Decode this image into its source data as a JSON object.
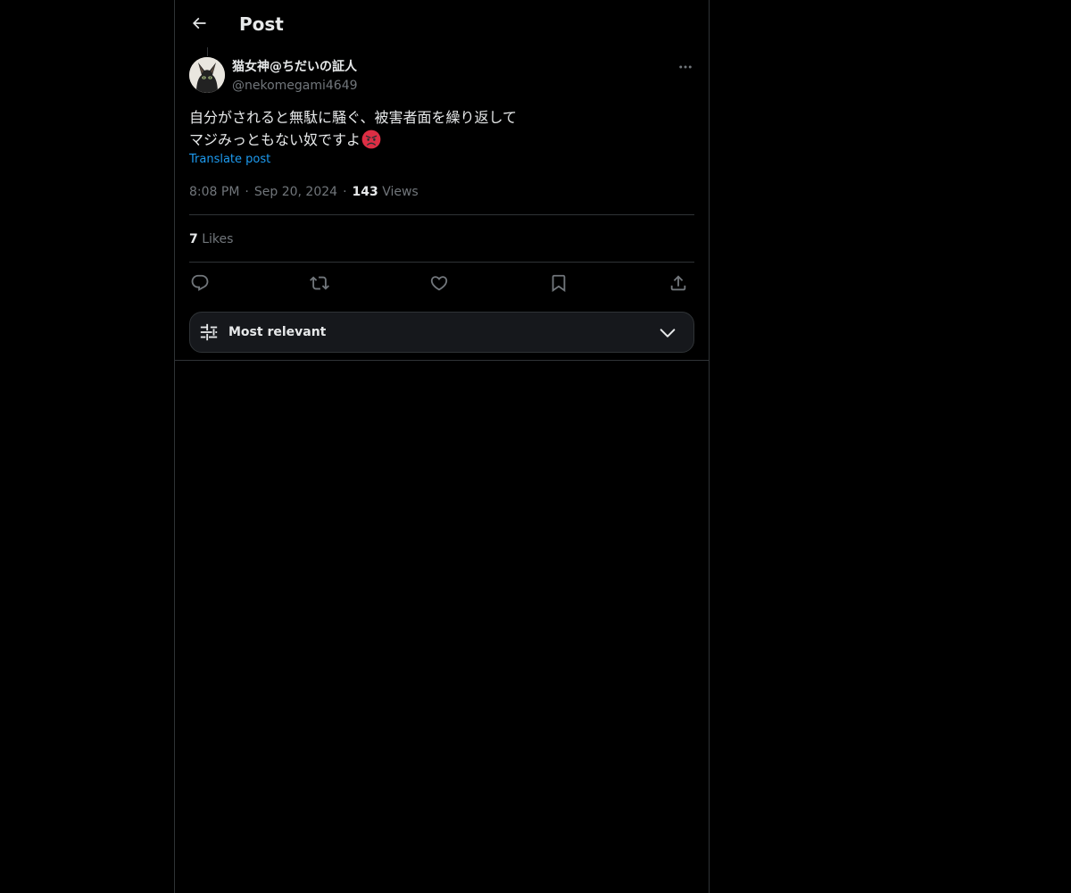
{
  "header": {
    "title": "Post",
    "back_icon": "arrow-left-icon"
  },
  "post": {
    "author": {
      "display_name": "猫女神@ちだいの証人",
      "handle": "@nekomegami4649",
      "avatar": "black-cat-avatar"
    },
    "text_lines": [
      "自分がされると無駄に騒ぐ、被害者面を繰り返して",
      "マジみっともない奴ですよ"
    ],
    "emoji": "angry-face-emoji",
    "translate_label": "Translate post",
    "time": "8:08 PM",
    "separator": "·",
    "date": "Sep 20, 2024",
    "views_count": "143",
    "views_label": "Views",
    "likes_count": "7",
    "likes_label": "Likes"
  },
  "actions": {
    "reply_icon": "reply-icon",
    "repost_icon": "repost-icon",
    "like_icon": "heart-icon",
    "bookmark_icon": "bookmark-icon",
    "share_icon": "share-icon"
  },
  "sort": {
    "label": "Most relevant",
    "icon": "sliders-icon",
    "chevron": "chevron-down-icon"
  },
  "colors": {
    "background": "#000000",
    "text_primary": "#e7e9ea",
    "text_secondary": "#71767b",
    "accent": "#1d9bf0",
    "border": "#2f3336"
  }
}
